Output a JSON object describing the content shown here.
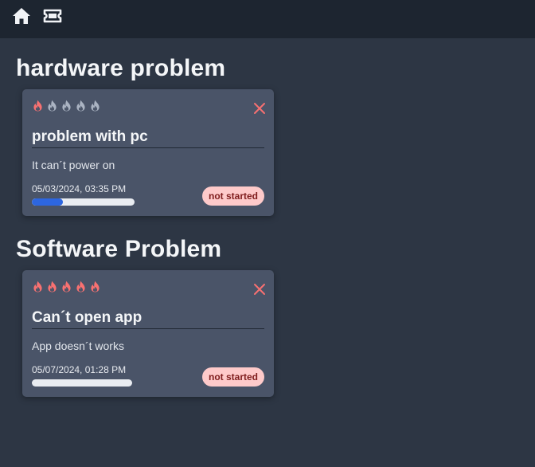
{
  "topbar": {
    "icons": [
      "home-icon",
      "ticket-icon"
    ],
    "background": "#1d2530"
  },
  "groups": [
    {
      "title": "hardware problem",
      "tickets": [
        {
          "priority": 1,
          "priority_max": 5,
          "title": "problem with pc",
          "description": "It can´t power on",
          "date": "05/03/2024, 03:35 PM",
          "progress": 0.3,
          "status": "not started"
        }
      ]
    },
    {
      "title": "Software Problem",
      "tickets": [
        {
          "priority": 5,
          "priority_max": 5,
          "title": "Can´t open app",
          "description": "App doesn´t works",
          "date": "05/07/2024, 01:28 PM",
          "progress": 0,
          "status": "not started"
        }
      ]
    }
  ],
  "colors": {
    "background": "#2d3644",
    "card": "#4a5468",
    "flame_active": "#f87171",
    "flame_inactive": "#aab3c2",
    "close": "#f87171",
    "progress": "#2d66e0",
    "status_badge_bg": "#fecaca",
    "status_badge_text": "#7f1d1d"
  }
}
